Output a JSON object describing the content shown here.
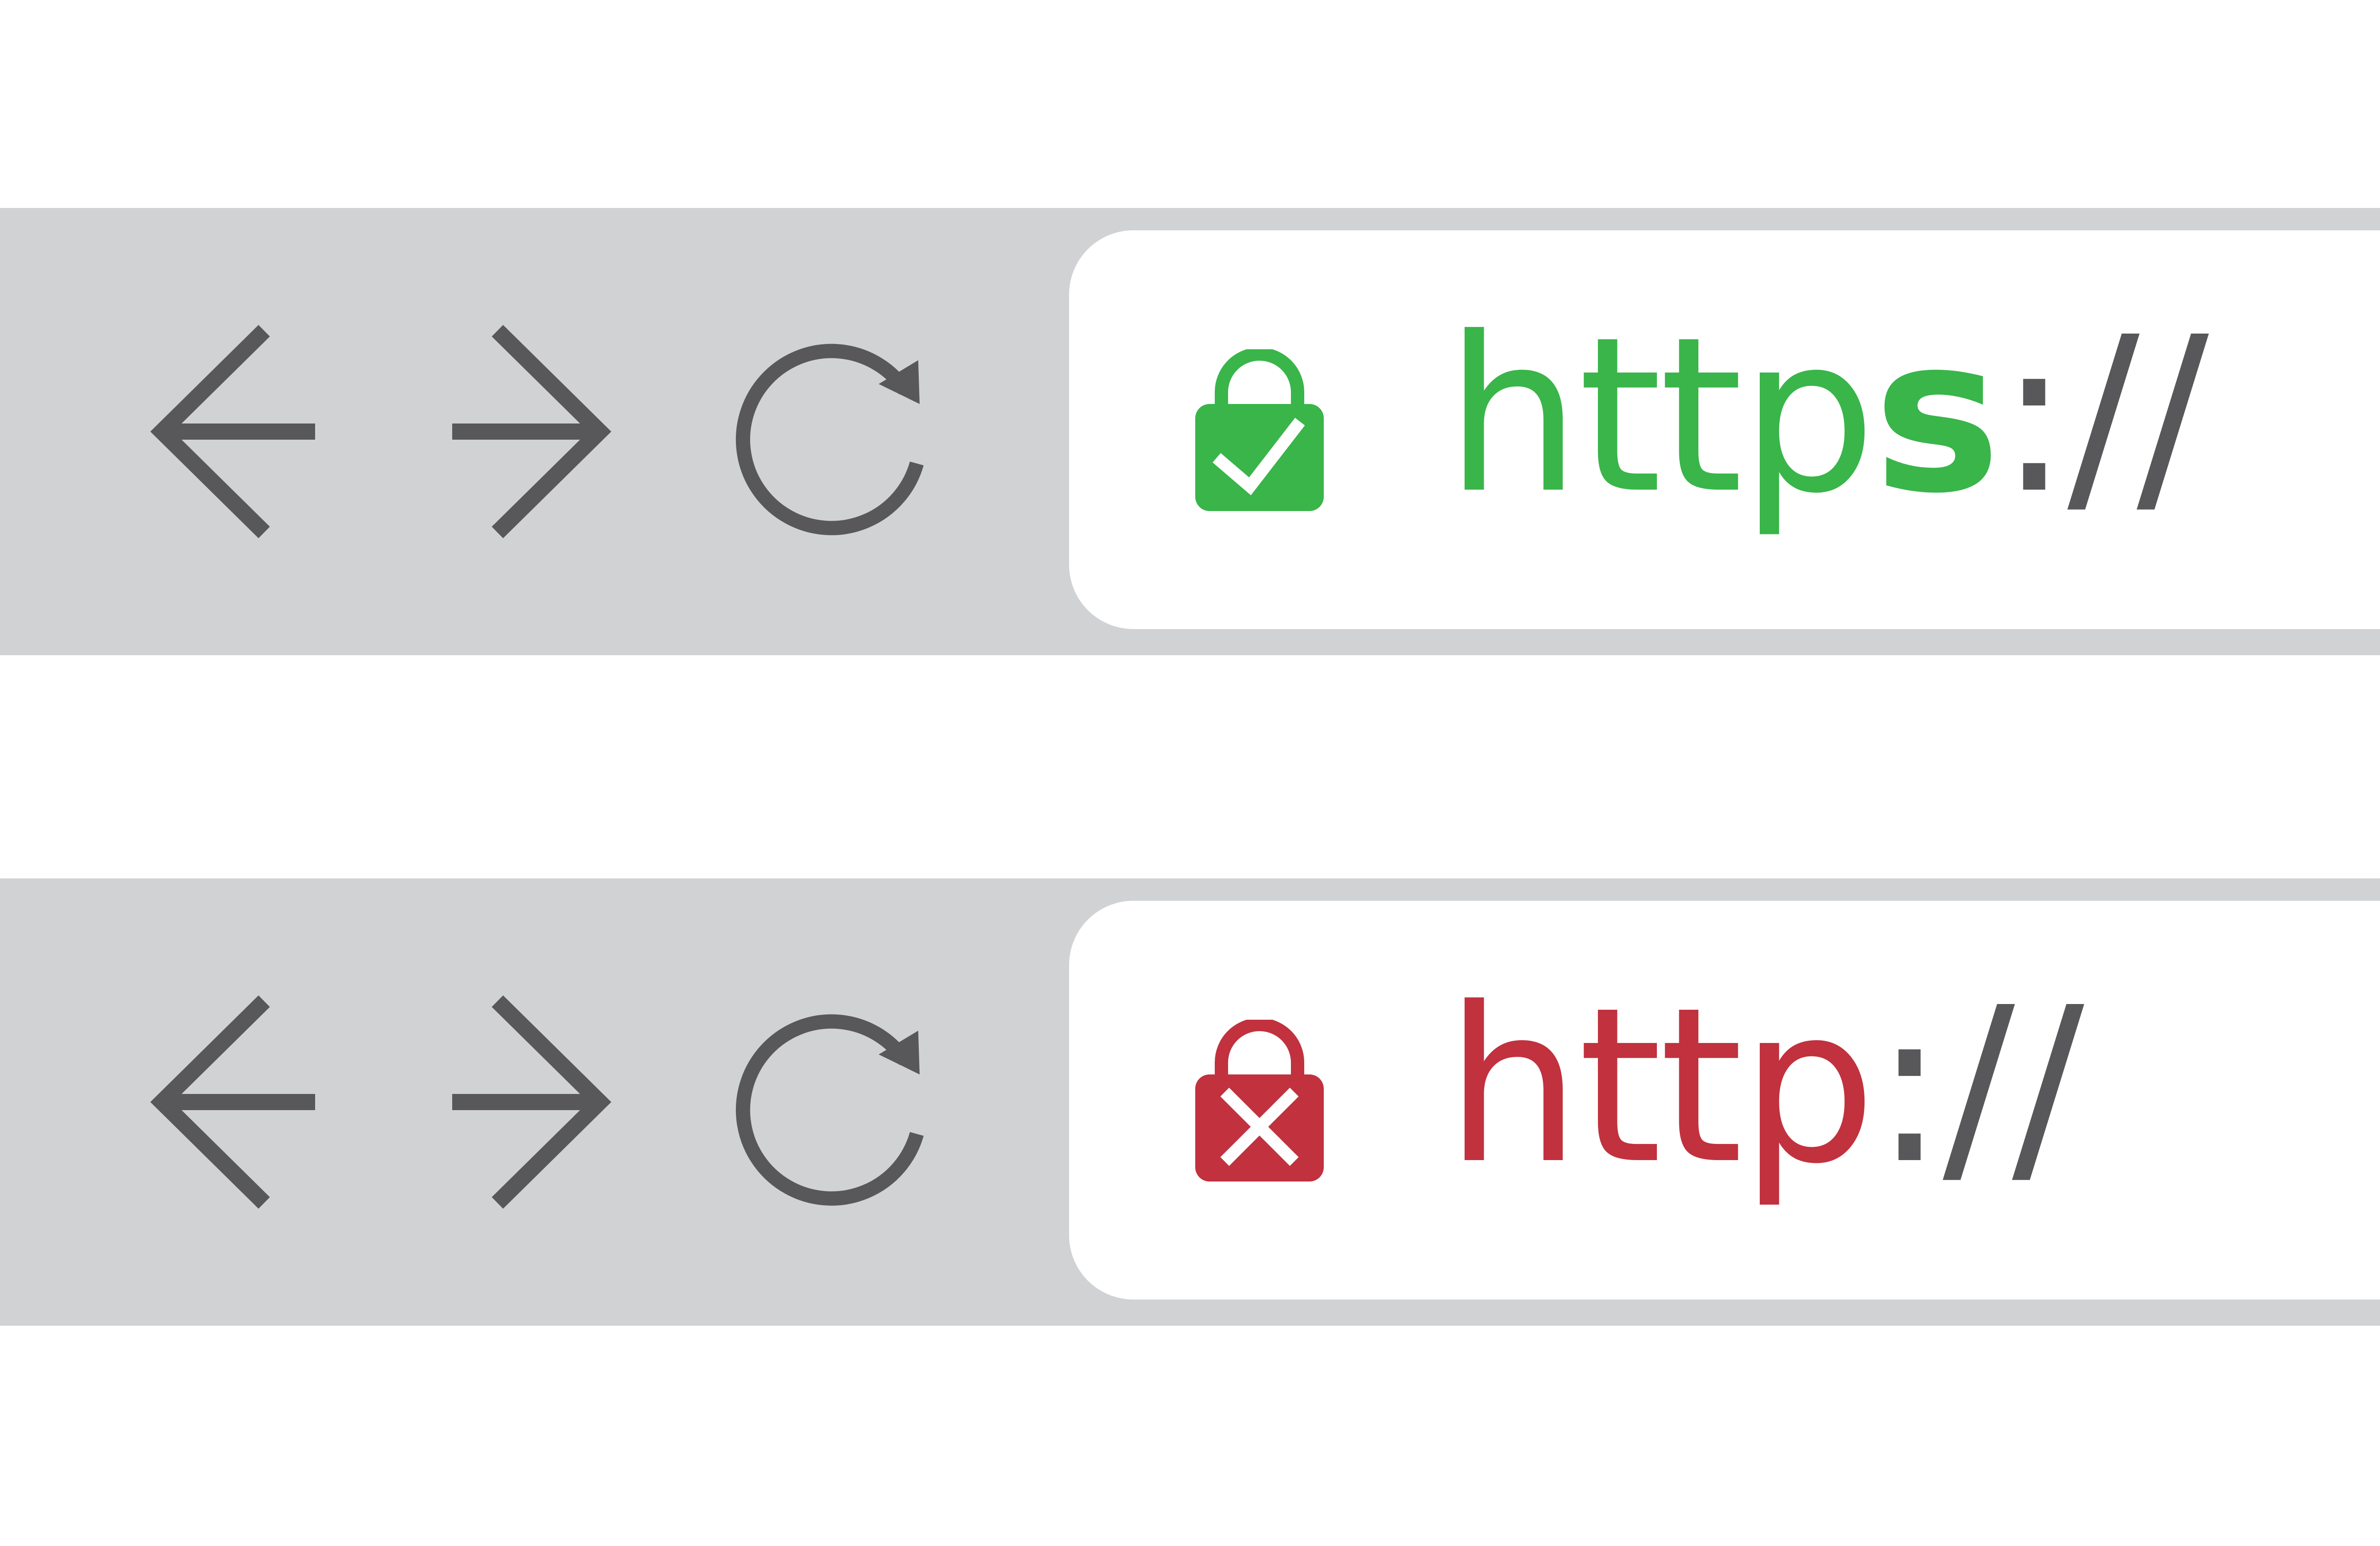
{
  "colors": {
    "bar_background": "#d1d2d4",
    "icon_gray": "#58585a",
    "secure_green": "#39b54a",
    "insecure_red": "#c1313e",
    "field_background": "#ffffff"
  },
  "icons": {
    "back": "arrow-left-icon",
    "forward": "arrow-right-icon",
    "reload": "reload-icon",
    "secure_lock": "lock-check-icon",
    "insecure_lock": "lock-x-icon"
  },
  "bars": [
    {
      "state": "secure",
      "url": {
        "protocol": "http",
        "suffix": "s",
        "separator": "://"
      }
    },
    {
      "state": "insecure",
      "url": {
        "protocol": "http",
        "suffix": "",
        "separator": "://"
      }
    }
  ]
}
